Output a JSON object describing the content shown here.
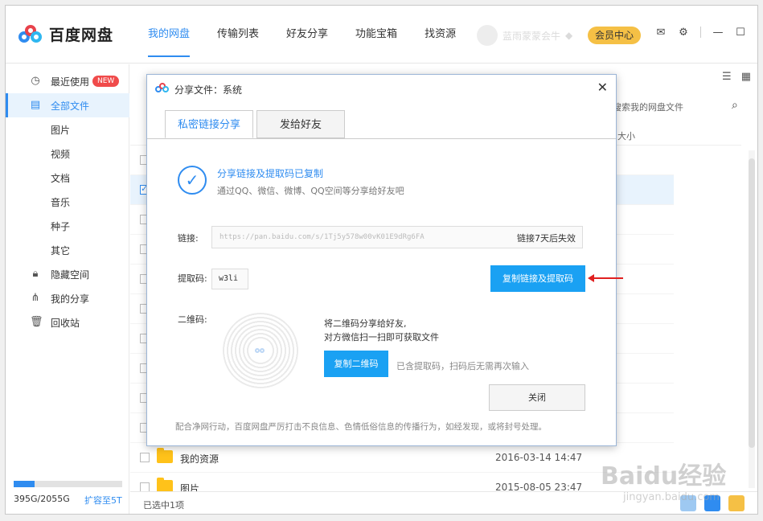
{
  "app": {
    "name": "百度网盘"
  },
  "nav": [
    {
      "label": "我的网盘",
      "active": true
    },
    {
      "label": "传输列表"
    },
    {
      "label": "好友分享"
    },
    {
      "label": "功能宝箱"
    },
    {
      "label": "找资源"
    }
  ],
  "user": {
    "name": "蓝雨蒙蒙会牛"
  },
  "vip_label": "会员中心",
  "sidebar": {
    "items": [
      {
        "label": "最近使用",
        "icon": "clock-icon",
        "badge": "NEW"
      },
      {
        "label": "全部文件",
        "icon": "document-icon",
        "active": true
      },
      {
        "label": "图片"
      },
      {
        "label": "视频"
      },
      {
        "label": "文档"
      },
      {
        "label": "音乐"
      },
      {
        "label": "种子"
      },
      {
        "label": "其它"
      },
      {
        "label": "隐藏空间",
        "icon": "lock-icon"
      },
      {
        "label": "我的分享",
        "icon": "share-icon"
      },
      {
        "label": "回收站",
        "icon": "trash-icon"
      }
    ],
    "quota_text": "395G/2055G",
    "quota_fraction": 0.19,
    "expand_label": "扩容至5T"
  },
  "main": {
    "search_placeholder": "搜索我的网盘文件",
    "size_header": "大小",
    "files": [
      {
        "name": "我的资源",
        "date": "2016-03-14 14:47"
      },
      {
        "name": "图片",
        "date": "2015-08-05 23:47"
      }
    ],
    "status": "已选中1项"
  },
  "dialog": {
    "title": "分享文件：系统",
    "tabs": [
      "私密链接分享",
      "发给好友"
    ],
    "success_title": "分享链接及提取码已复制",
    "success_sub": "通过QQ、微信、微博、QQ空间等分享给好友吧",
    "link_label": "链接:",
    "link_url": "https://pan.baidu.com/s/1Tj5y578w00vK01E9dRg6FA",
    "link_expire": "链接7天后失效",
    "code_label": "提取码:",
    "code_value": "w3li",
    "copy_link_button": "复制链接及提取码",
    "qr_label": "二维码:",
    "qr_text_1": "将二维码分享给好友,",
    "qr_text_2": "对方微信扫一扫即可获取文件",
    "copy_qr_button": "复制二维码",
    "qr_note": "已含提取码，扫码后无需再次输入",
    "close_button": "关闭",
    "footer_note": "配合净网行动，百度网盘严厉打击不良信息、色情低俗信息的传播行为，如经发现，或将封号处理。"
  },
  "colors": {
    "accent": "#2f8cf0",
    "primary_button": "#1aa1f3",
    "vip": "#f5c045",
    "annotation_arrow": "#e02020"
  },
  "watermark": {
    "text": "Baidu经验",
    "sub": "jingyan.baidu.com"
  }
}
